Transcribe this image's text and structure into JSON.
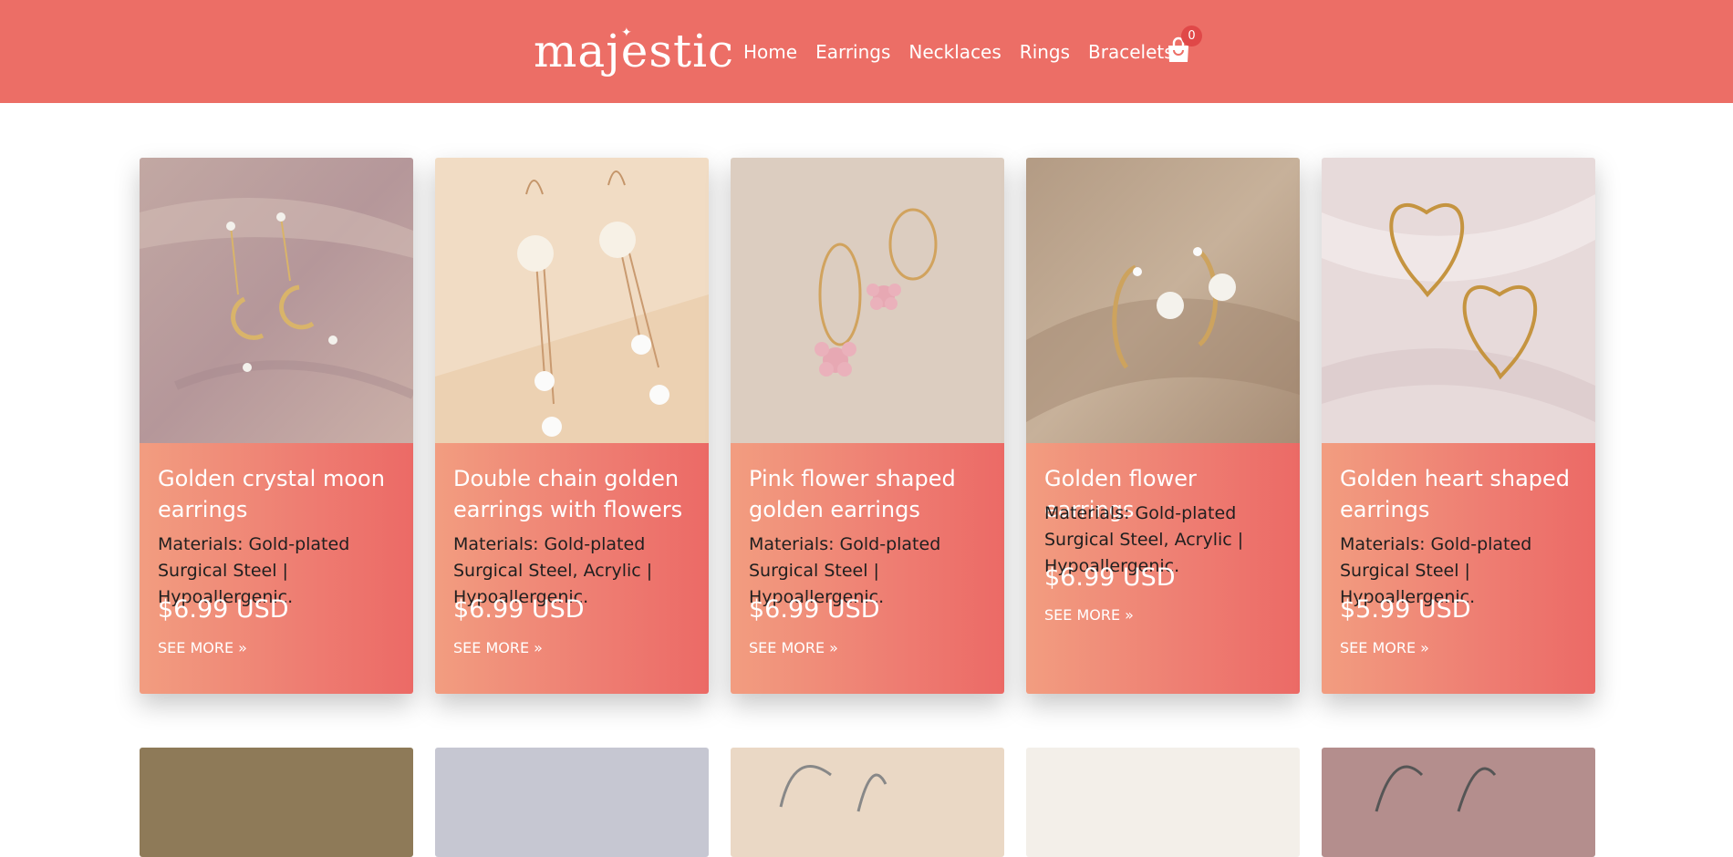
{
  "brand": {
    "logo_text": "majestic",
    "colors": {
      "header": "#ec6e66",
      "badge": "#e04848"
    }
  },
  "nav": {
    "items": [
      "Home",
      "Earrings",
      "Necklaces",
      "Rings",
      "Bracelets"
    ]
  },
  "cart": {
    "icon": "shopping-bag-icon",
    "count": "0"
  },
  "products": [
    {
      "title": "Golden crystal moon earrings",
      "description": "Materials: Gold-plated Surgical Steel | Hypoallergenic.",
      "price": "$6.99 USD",
      "link": "SEE MORE »"
    },
    {
      "title": "Double chain golden earrings with flowers",
      "description": "Materials: Gold-plated Surgical Steel, Acrylic | Hypoallergenic.",
      "price": "$6.99 USD",
      "link": "SEE MORE »"
    },
    {
      "title": "Pink flower shaped golden earrings",
      "description": "Materials: Gold-plated Surgical Steel | Hypoallergenic.",
      "price": "$6.99 USD",
      "link": "SEE MORE »"
    },
    {
      "title": "Golden flower earrings",
      "description": "Materials: Gold-plated Surgical Steel, Acrylic | Hypoallergenic.",
      "price": "$6.99 USD",
      "link": "SEE MORE »"
    },
    {
      "title": "Golden heart shaped earrings",
      "description": "Materials: Gold-plated Surgical Steel | Hypoallergenic.",
      "price": "$5.99 USD",
      "link": "SEE MORE »"
    }
  ]
}
